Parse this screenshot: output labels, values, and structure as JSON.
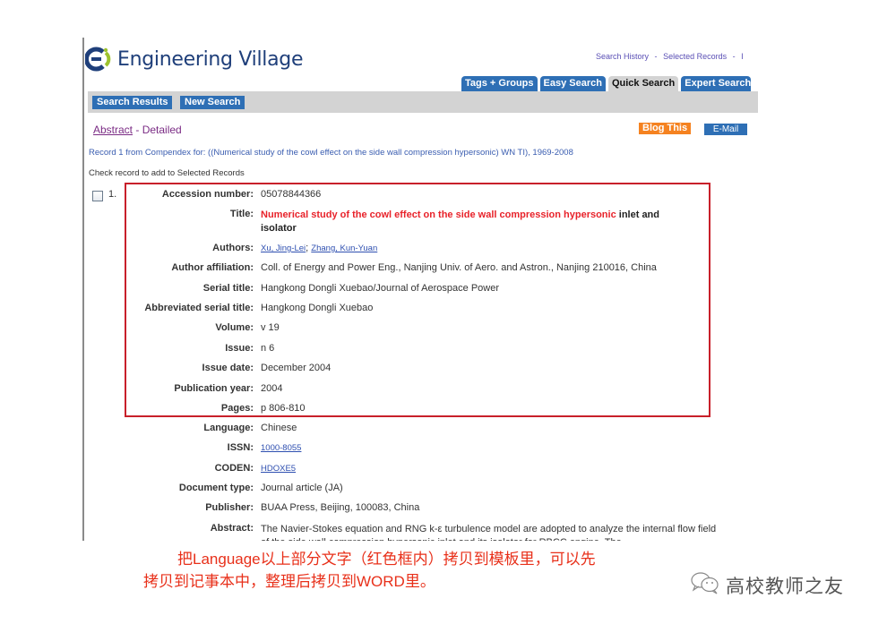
{
  "header": {
    "logo_text": "Engineering Village",
    "top_links": [
      "Search History",
      "Selected Records",
      "I"
    ],
    "top_link_separator": "-"
  },
  "tabs": [
    {
      "label": "Tags + Groups",
      "active": false
    },
    {
      "label": "Easy Search",
      "active": false
    },
    {
      "label": "Quick Search",
      "active": true
    },
    {
      "label": "Expert Search",
      "active": false
    }
  ],
  "nav": {
    "search_results_label": "Search Results",
    "new_search_label": "New Search"
  },
  "view": {
    "abstract_link": "Abstract",
    "separator": " - ",
    "detailed_label": "Detailed",
    "blog_this_label": "Blog This",
    "email_label": "E-Mail"
  },
  "record_info": "Record 1 from Compendex for: ((Numerical study of the cowl effect on the side wall compression hypersonic) WN TI), 1969-2008",
  "check_info": "Check record to add to Selected Records",
  "record": {
    "number": "1.",
    "accession_number": {
      "label": "Accession number:",
      "value": "05078844366"
    },
    "title": {
      "label": "Title:",
      "value_highlight": "Numerical study of the cowl effect on the side wall compression hypersonic",
      "value_rest": " inlet and isolator"
    },
    "authors": {
      "label": "Authors:",
      "values": [
        "Xu, Jing-Lei",
        "Zhang, Kun-Yuan"
      ],
      "separator": "; "
    },
    "author_affiliation": {
      "label": "Author affiliation:",
      "value": "Coll. of Energy and Power Eng., Nanjing Univ. of Aero. and Astron., Nanjing 210016, China"
    },
    "serial_title": {
      "label": "Serial title:",
      "value": "Hangkong Dongli Xuebao/Journal of Aerospace Power"
    },
    "abbreviated_serial_title": {
      "label": "Abbreviated serial title:",
      "value": "Hangkong Dongli Xuebao"
    },
    "volume": {
      "label": "Volume:",
      "value": "v 19"
    },
    "issue": {
      "label": "Issue:",
      "value": "n 6"
    },
    "issue_date": {
      "label": "Issue date:",
      "value": "December 2004"
    },
    "publication_year": {
      "label": "Publication year:",
      "value": "2004"
    },
    "pages": {
      "label": "Pages:",
      "value": "p 806-810"
    },
    "language": {
      "label": "Language:",
      "value": "Chinese"
    },
    "issn": {
      "label": "ISSN:",
      "value": "1000-8055"
    },
    "coden": {
      "label": "CODEN:",
      "value": "HDOXE5"
    },
    "document_type": {
      "label": "Document type:",
      "value": "Journal article (JA)"
    },
    "publisher": {
      "label": "Publisher:",
      "value": "BUAA Press, Beijing, 100083, China"
    },
    "abstract": {
      "label": "Abstract:",
      "value": "The Navier-Stokes equation and RNG k-ε turbulence model are adopted to analyze the internal flow field of the side wall compression hypersonic inlet and its isolator for RBCC engine. The"
    }
  },
  "caption": {
    "line1": "把Language以上部分文字（红色框内）拷贝到模板里，可以先",
    "line2": "拷贝到记事本中，整理后拷贝到WORD里。"
  },
  "watermark": {
    "text": "高校教师之友"
  },
  "colors": {
    "brand_blue": "#2e6fb5",
    "highlight_red": "#e8222a",
    "box_red": "#c8202a",
    "blog_orange": "#f58220"
  }
}
